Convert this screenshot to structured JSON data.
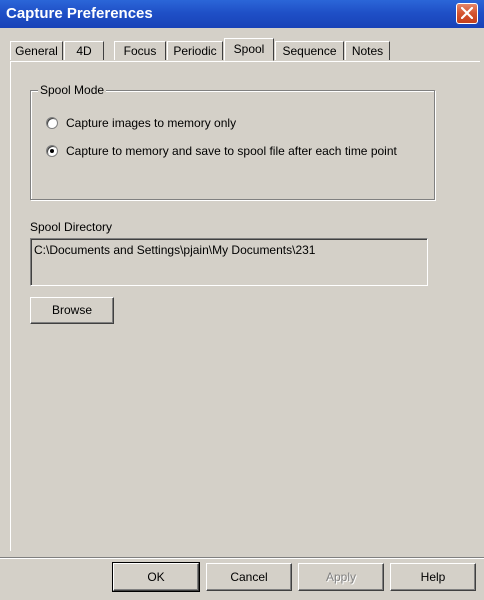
{
  "window": {
    "title": "Capture Preferences",
    "close_icon": "close-icon"
  },
  "tabs": [
    {
      "label": "General"
    },
    {
      "label": "4D"
    },
    {
      "label": "Focus"
    },
    {
      "label": "Periodic"
    },
    {
      "label": "Spool",
      "active": true
    },
    {
      "label": "Sequence"
    },
    {
      "label": "Notes"
    }
  ],
  "spool_mode": {
    "legend": "Spool Mode",
    "options": [
      {
        "label": "Capture images to memory only",
        "checked": false
      },
      {
        "label": "Capture to memory and save to spool file after each time point",
        "checked": true
      }
    ]
  },
  "spool_directory": {
    "label": "Spool Directory",
    "value": "C:\\Documents and Settings\\pjain\\My Documents\\231"
  },
  "buttons": {
    "browse": "Browse",
    "ok": "OK",
    "cancel": "Cancel",
    "apply": "Apply",
    "help": "Help"
  },
  "colors": {
    "titlebar": "#1f50c7",
    "dialog_bg": "#d4d0c8",
    "close_button": "#d4532f"
  }
}
